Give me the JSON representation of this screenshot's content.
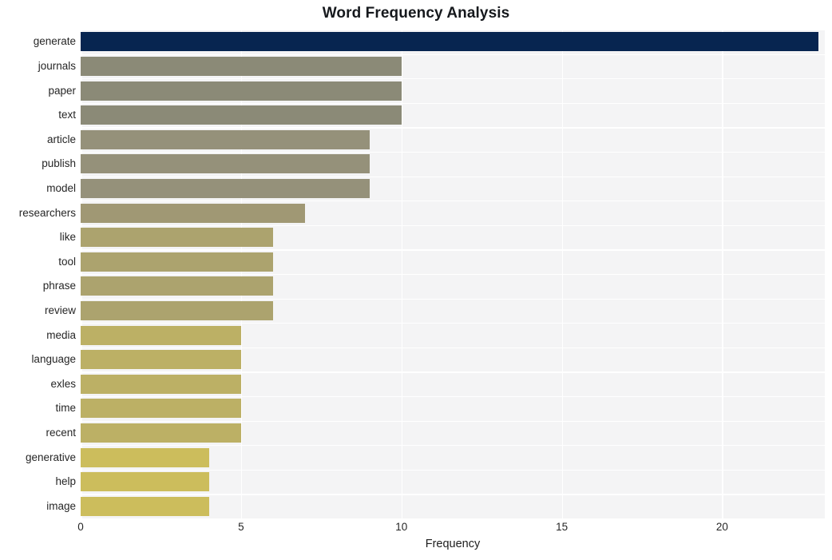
{
  "chart_data": {
    "type": "bar",
    "orientation": "horizontal",
    "title": "Word Frequency Analysis",
    "xlabel": "Frequency",
    "ylabel": "",
    "xlim": [
      0,
      23.2
    ],
    "ylim": [
      0,
      20
    ],
    "grid": true,
    "legend": null,
    "xticks": [
      0,
      5,
      10,
      15,
      20
    ],
    "xtick_labels": [
      "0",
      "5",
      "10",
      "15",
      "20"
    ],
    "categories": [
      "generate",
      "journals",
      "paper",
      "text",
      "article",
      "publish",
      "model",
      "researchers",
      "like",
      "tool",
      "phrase",
      "review",
      "media",
      "language",
      "exles",
      "time",
      "recent",
      "generative",
      "help",
      "image"
    ],
    "values": [
      23,
      10,
      10,
      10,
      9,
      9,
      9,
      7,
      6,
      6,
      6,
      6,
      5,
      5,
      5,
      5,
      5,
      4,
      4,
      4
    ],
    "bar_colors": [
      "#072550",
      "#8b8a77",
      "#8b8a77",
      "#8b8a77",
      "#95917a",
      "#95917a",
      "#95917a",
      "#a09874",
      "#aca36e",
      "#aca36e",
      "#aca36e",
      "#aca36e",
      "#bcb065",
      "#bcb065",
      "#bcb065",
      "#bcb065",
      "#bcb065",
      "#ccbd5c",
      "#ccbd5c",
      "#ccbd5c"
    ],
    "plot_background": "#f4f4f5",
    "figure_background": "#ffffff",
    "gridline_color": "#ffffff",
    "text_color": "#262626"
  }
}
